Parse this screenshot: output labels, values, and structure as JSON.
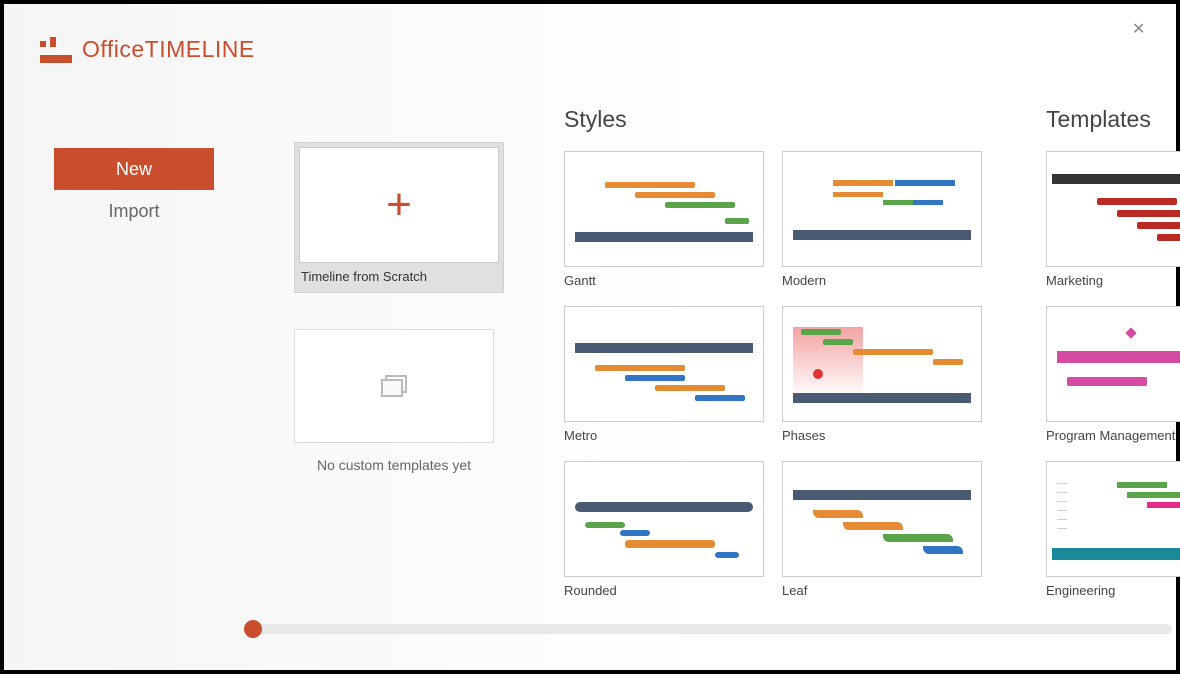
{
  "app": {
    "brand_prefix": "Office",
    "brand_suffix": "TIMELINE"
  },
  "nav": {
    "new": "New",
    "import": "Import"
  },
  "first_col": {
    "scratch_label": "Timeline from Scratch",
    "custom_label": "No custom templates yet"
  },
  "sections": {
    "styles": "Styles",
    "templates": "Templates"
  },
  "styles": {
    "gantt": "Gantt",
    "modern": "Modern",
    "metro": "Metro",
    "phases": "Phases",
    "rounded": "Rounded",
    "leaf": "Leaf"
  },
  "templates": {
    "marketing": "Marketing",
    "program_mgmt": "Program Management",
    "engineering": "Engineering"
  }
}
